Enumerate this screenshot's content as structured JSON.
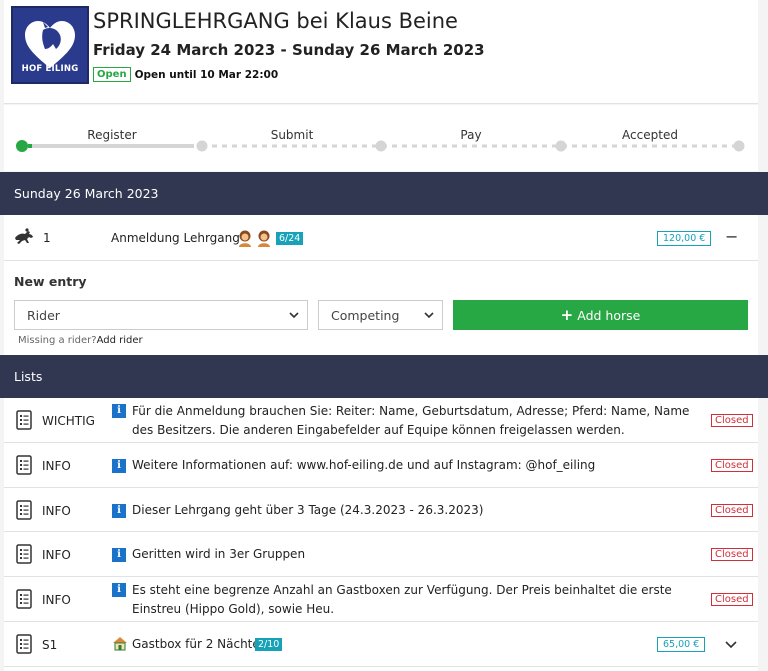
{
  "header": {
    "logo_text": "HOF EILING",
    "title": "SPRINGLEHRGANG bei Klaus Beine",
    "dates": "Friday 24 March 2023 - Sunday 26 March 2023",
    "status_badge": "Open",
    "open_until": "Open until 10 Mar 22:00"
  },
  "steps": [
    "Register",
    "Submit",
    "Pay",
    "Accepted"
  ],
  "day_section": {
    "title": "Sunday 26 March 2023",
    "event": {
      "number": "1",
      "name": "Anmeldung Lehrgang",
      "count": "6/24",
      "price": "120,00 €",
      "collapse_symbol": "−"
    },
    "new_entry": {
      "heading": "New entry",
      "rider_select": "Rider",
      "status_select": "Competing",
      "add_button_icon": "+",
      "add_button": "Add horse",
      "missing_text": "Missing a rider?",
      "add_rider_link": "Add rider"
    }
  },
  "lists_section": {
    "title": "Lists",
    "closed_label": "Closed",
    "info_glyph": "i",
    "rows": [
      {
        "code": "WICHTIG",
        "text": "Für die Anmeldung brauchen Sie: Reiter: Name, Geburtsdatum, Adresse; Pferd: Name, Name des Besitzers. Die anderen Eingabefelder auf Equipe können freigelassen werden."
      },
      {
        "code": "INFO",
        "text": "Weitere Informationen auf: www.hof-eiling.de und auf Instagram: @hof_eiling"
      },
      {
        "code": "INFO",
        "text": "Dieser Lehrgang geht über 3 Tage (24.3.2023 - 26.3.2023)"
      },
      {
        "code": "INFO",
        "text": "Geritten wird in 3er Gruppen"
      },
      {
        "code": "INFO",
        "text": "Es steht eine begrenze Anzahl an Gastboxen zur Verfügung. Der Preis beinhaltet die erste Einstreu (Hippo Gold), sowie Heu."
      }
    ],
    "stable_row": {
      "code": "S1",
      "text": "Gastbox für 2 Nächte",
      "count": "2/10",
      "price": "65,00 €"
    }
  },
  "colors": {
    "section_bar": "#313651",
    "green": "#28a745",
    "teal": "#17a2b8",
    "closed_red": "#d0303a",
    "info_blue": "#1a73c8"
  }
}
